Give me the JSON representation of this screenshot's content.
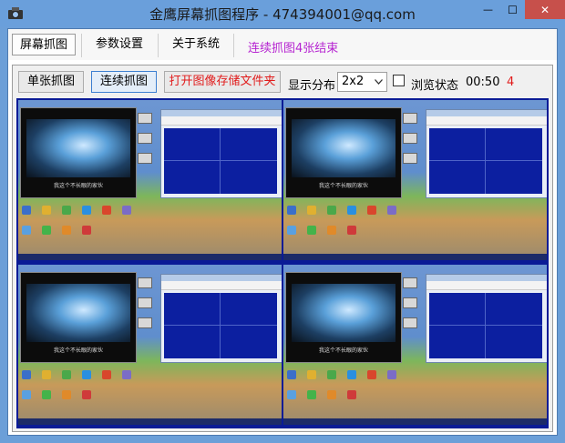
{
  "window": {
    "title": "金鹰屏幕抓图程序 - 474394001@qq.com",
    "minimize_glyph": "—",
    "maximize_glyph": "☐",
    "close_glyph": "✕"
  },
  "tabs": [
    {
      "label": "屏幕抓图",
      "active": true
    },
    {
      "label": "参数设置",
      "active": false
    },
    {
      "label": "关于系统",
      "active": false
    }
  ],
  "status_message": "连续抓图4张结束",
  "toolbar": {
    "single_capture": "单张抓图",
    "continuous_capture": "连续抓图",
    "open_folder": "打开图像存储文件夹",
    "layout_label": "显示分布",
    "layout_value": "2x2",
    "browse_label": "浏览状态",
    "browse_checked": false,
    "timer": "00:50",
    "count": "4"
  },
  "colors": {
    "accent_purple": "#b624d1",
    "alert_red": "#e11b1b",
    "grid_blue": "#0a1b96"
  },
  "thumbnails": [
    {
      "caption": "我这个不长眼的家伙"
    },
    {
      "caption": "我这个不长眼的家伙"
    },
    {
      "caption": "我这个不长眼的家伙"
    },
    {
      "caption": "我这个不长眼的家伙"
    }
  ]
}
